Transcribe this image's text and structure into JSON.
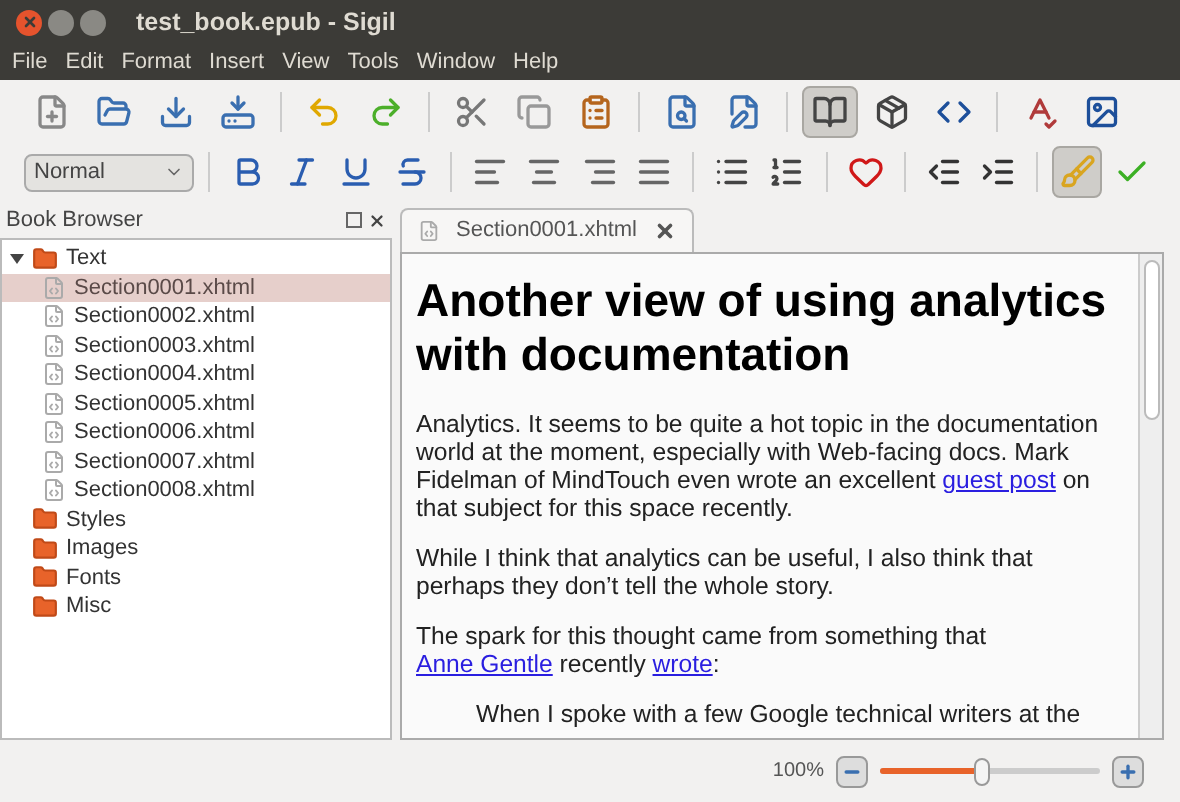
{
  "window": {
    "title": "test_book.epub - Sigil"
  },
  "menu": [
    "File",
    "Edit",
    "Format",
    "Insert",
    "View",
    "Tools",
    "Window",
    "Help"
  ],
  "toolbar_top": [
    {
      "selected": false
    },
    {
      "selected": false
    },
    {
      "selected": false
    },
    {
      "selected": false
    },
    {
      "selected": false
    },
    {
      "selected": false
    },
    {
      "selected": false
    },
    {
      "selected": false
    },
    {
      "selected": false
    },
    {
      "selected": false
    },
    {
      "selected": false
    },
    {
      "selected": true
    },
    {
      "selected": false
    },
    {
      "selected": false
    },
    {
      "selected": false
    },
    {
      "selected": false
    }
  ],
  "style_select": {
    "value": "Normal"
  },
  "toolbar_format": [
    {
      "selected": false
    },
    {
      "selected": false
    },
    {
      "selected": false
    },
    {
      "selected": false
    },
    {
      "selected": false
    },
    {
      "selected": false
    },
    {
      "selected": false
    },
    {
      "selected": false
    },
    {
      "selected": false
    },
    {
      "selected": false
    },
    {
      "selected": false
    },
    {
      "selected": false
    },
    {
      "selected": false
    },
    {
      "selected": true
    },
    {
      "selected": false
    }
  ],
  "book_browser": {
    "title": "Book Browser",
    "tree": [
      {
        "label": "Text",
        "kind": "folder",
        "expanded": true,
        "selected": false,
        "children": [
          {
            "label": "Section0001.xhtml",
            "kind": "file",
            "selected": true
          },
          {
            "label": "Section0002.xhtml",
            "kind": "file",
            "selected": false
          },
          {
            "label": "Section0003.xhtml",
            "kind": "file",
            "selected": false
          },
          {
            "label": "Section0004.xhtml",
            "kind": "file",
            "selected": false
          },
          {
            "label": "Section0005.xhtml",
            "kind": "file",
            "selected": false
          },
          {
            "label": "Section0006.xhtml",
            "kind": "file",
            "selected": false
          },
          {
            "label": "Section0007.xhtml",
            "kind": "file",
            "selected": false
          },
          {
            "label": "Section0008.xhtml",
            "kind": "file",
            "selected": false
          }
        ]
      },
      {
        "label": "Styles",
        "kind": "folder",
        "selected": false
      },
      {
        "label": "Images",
        "kind": "folder",
        "selected": false
      },
      {
        "label": "Fonts",
        "kind": "folder",
        "selected": false
      },
      {
        "label": "Misc",
        "kind": "folder",
        "selected": false
      }
    ]
  },
  "editor": {
    "tab": {
      "label": "Section0001.xhtml",
      "selected": true
    },
    "heading": "Another view of using analytics with documentation",
    "paragraphs": [
      [
        {
          "text": "Analytics. It seems to be quite a hot topic in the documentation world at the moment, especially with Web-facing docs. Mark Fidelman of MindTouch even wrote an excellent ",
          "link": false
        },
        {
          "text": "guest post",
          "link": true
        },
        {
          "text": " on that subject for this space recently.",
          "link": false
        }
      ],
      [
        {
          "text": "While I think that analytics can be useful, I also think that perhaps they don’t tell the whole story.",
          "link": false
        }
      ],
      [
        {
          "text": "The spark for this thought came from something that ",
          "link": false
        },
        {
          "text": "Anne Gentle",
          "link": true
        },
        {
          "text": " recently ",
          "link": false
        },
        {
          "text": "wrote",
          "link": true
        },
        {
          "text": ":",
          "link": false
        }
      ]
    ],
    "quote": "When I spoke with a few Google technical writers at the"
  },
  "status_bar": {
    "zoom": "100%",
    "level": 0.46
  }
}
